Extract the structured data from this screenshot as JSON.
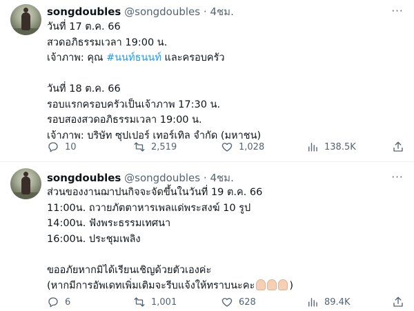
{
  "tweets": [
    {
      "name": "songdoubles",
      "handle": "@songdoubles",
      "dot": "·",
      "time": "4ชม.",
      "more": "···",
      "lines": [
        "วันที่ 17 ต.ค. 66",
        "สวดอภิธรรมเวลา 19:00 น.",
        "",
        "",
        "วันที่ 18 ต.ค. 66",
        "รอบแรกครอบครัวเป็นเจ้าภาพ 17:30 น.",
        "รอบสองสวดอภิธรรมเวลา 19:00 น.",
        "เจ้าภาพ: บริษัท ซุปเปอร์ เทอร์เทิล จำกัด (มหาชน)"
      ],
      "host_line": {
        "prefix": "เจ้าภาพ: คุณ ",
        "hashtag": "#นนท์ธนนท์",
        "suffix": " และครอบครัว"
      },
      "replies": "10",
      "retweets": "2,519",
      "likes": "1,028",
      "views": "138.5K"
    },
    {
      "name": "songdoubles",
      "handle": "@songdoubles",
      "dot": "·",
      "time": "4ชม.",
      "more": "···",
      "lines": [
        "ส่วนของงานฌาปนกิจจะจัดขึ้นในวันที่ 19 ต.ค. 66",
        "11:00น. ถวายภัตตาหารเพลแด่พระสงฆ์ 10 รูป",
        "14:00น. ฟังพระธรรมเทศนา",
        "16:00น. ประชุมเพลิง",
        "",
        "ขออภัยหากมิได้เรียนเชิญด้วยตัวเองค่ะ",
        "(หากมีการอัพเดทเพิ่มเติมจะรีบแจ้งให้ทราบนะคะ",
        ")"
      ],
      "replies": "6",
      "retweets": "1,001",
      "likes": "628",
      "views": "89.4K"
    }
  ],
  "icons": {
    "reply": "reply-icon",
    "retweet": "retweet-icon",
    "like": "heart-icon",
    "views": "views-icon",
    "share": "share-icon",
    "emoji": "folded-hands-emoji"
  },
  "colors": {
    "text": "#0f1419",
    "muted": "#536471",
    "link": "#1d9bf0",
    "border": "#eff3f4"
  }
}
